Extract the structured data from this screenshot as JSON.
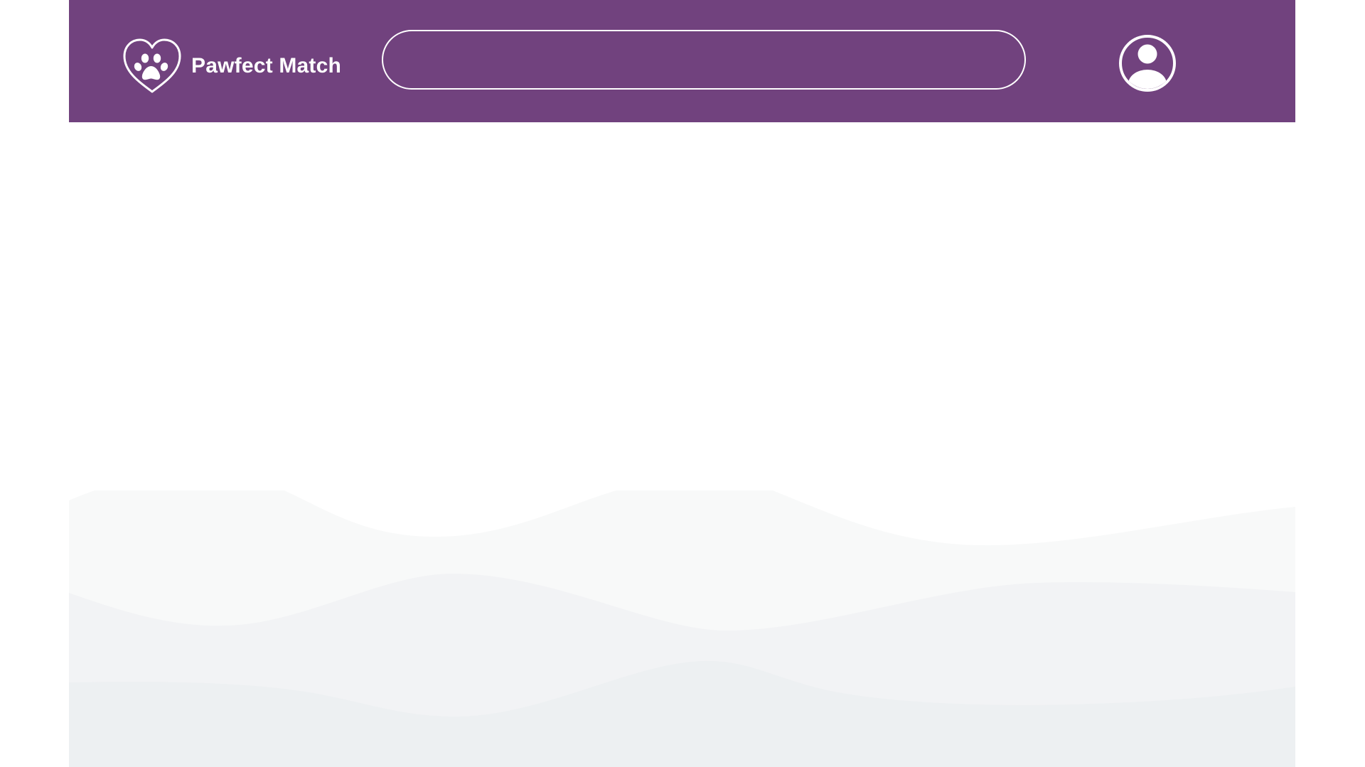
{
  "header": {
    "brand_name": "Pawfect Match",
    "background_color": "#71427e",
    "search": {
      "value": "",
      "placeholder": ""
    },
    "profile_icon": "user-profile-icon",
    "logo_icon": "heart-paw-icon"
  },
  "main": {
    "background_color": "#ffffff",
    "wave_colors": [
      "#f8f9f9",
      "#f2f3f5",
      "#edf0f2"
    ]
  }
}
